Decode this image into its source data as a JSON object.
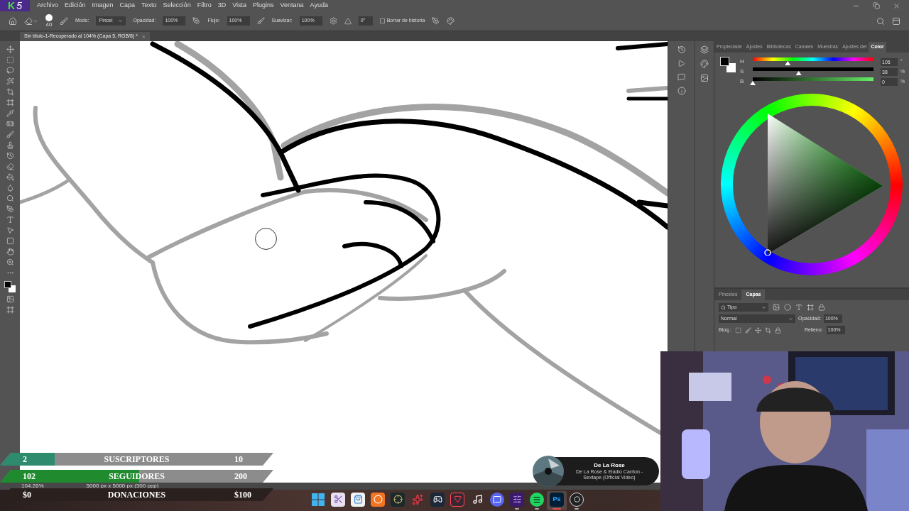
{
  "logo": {
    "letter": "K",
    "number": "5"
  },
  "menu": [
    "Archivo",
    "Edición",
    "Imagen",
    "Capa",
    "Texto",
    "Selección",
    "Filtro",
    "3D",
    "Vista",
    "Plugins",
    "Ventana",
    "Ayuda"
  ],
  "options": {
    "brush_size": "40",
    "mode_label": "Modo:",
    "mode": "Pincel",
    "opacity_label": "Opacidad:",
    "opacity": "100%",
    "flow_label": "Flujo:",
    "flow": "100%",
    "smooth_label": "Suavizar:",
    "smooth": "100%",
    "angle": "0°",
    "history_label": "Borrar de historia",
    "history_checked": false
  },
  "document_tab": {
    "title": "Sin título-1-Recuperado al 104% (Capa 5, RGB/8) *",
    "close": "×"
  },
  "color_panel": {
    "tabs": [
      {
        "label": "Propiedade",
        "selected": false
      },
      {
        "label": "Ajustes",
        "selected": false
      },
      {
        "label": "Bibliotecas",
        "selected": false
      },
      {
        "label": "Canales",
        "selected": false
      },
      {
        "label": "Muestras",
        "selected": false
      },
      {
        "label": "Ajustes del",
        "selected": false
      },
      {
        "label": "Color",
        "selected": true
      }
    ],
    "sliders": [
      {
        "kind": "hue",
        "label": "H",
        "level": 0.29,
        "value": "105",
        "unit": "°"
      },
      {
        "kind": "saturation",
        "label": "S",
        "level": 0.38,
        "value": "38",
        "unit": "%"
      },
      {
        "kind": "brightness",
        "label": "B",
        "level": 0,
        "value": "0",
        "unit": "%"
      }
    ]
  },
  "layers_panel": {
    "tabs": [
      {
        "label": "Pinceles",
        "selected": false
      },
      {
        "label": "Capas",
        "selected": true
      }
    ],
    "filter": "Tipo",
    "blend": "Normal",
    "opacity_label": "Opacidad:",
    "opacity": "100%",
    "lock_label": "Bloq.:",
    "fill_label": "Relleno:",
    "fill": "100%"
  },
  "status_bar": {
    "zoom": "104.26%",
    "size": "5000 px x 5000 px (300 ppp)"
  },
  "goals": [
    {
      "kind": "light",
      "current": "2",
      "label": "SUSCRIPTORES",
      "target": "10",
      "level": 0.2,
      "color": "#2e8b6e"
    },
    {
      "kind": "light",
      "current": "102",
      "label": "SEGUIDORES",
      "target": "200",
      "level": 0.51,
      "color": "#1f8a2e"
    },
    {
      "kind": "dark",
      "current": "$0",
      "label": "DONACIONES",
      "target": "$100"
    }
  ],
  "now_playing": {
    "title": "De La Rose",
    "subtitle": "De La Rose & Eladio Carrion - Sextape (Official Video)"
  },
  "taskbar": [
    {
      "kind": "windows",
      "running": false,
      "active": false
    },
    {
      "kind": "snip",
      "running": false,
      "active": false
    },
    {
      "kind": "store",
      "running": false,
      "active": false
    },
    {
      "kind": "crunchy",
      "running": false,
      "active": false
    },
    {
      "kind": "league",
      "running": false,
      "active": false
    },
    {
      "kind": "riot",
      "running": false,
      "active": false
    },
    {
      "kind": "steam",
      "running": false,
      "active": false
    },
    {
      "kind": "valorant",
      "running": false,
      "active": false
    },
    {
      "kind": "tiktok",
      "running": false,
      "active": false
    },
    {
      "kind": "discord",
      "running": false,
      "active": false
    },
    {
      "kind": "app",
      "running": true,
      "active": false
    },
    {
      "kind": "spotify",
      "running": true,
      "active": false
    },
    {
      "kind": "photoshop",
      "label": "Ps",
      "running": true,
      "active": true
    },
    {
      "kind": "obs",
      "running": true,
      "active": false
    }
  ]
}
